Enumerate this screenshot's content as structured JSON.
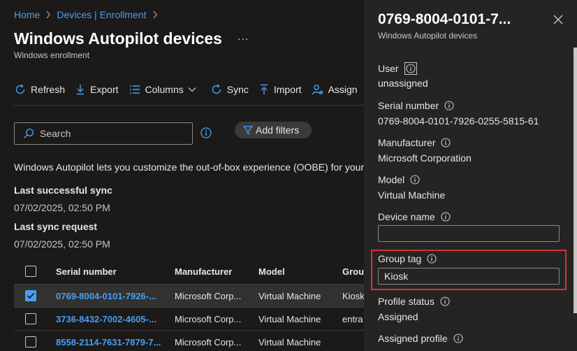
{
  "breadcrumb": {
    "items": [
      "Home",
      "Devices | Enrollment"
    ]
  },
  "page": {
    "title": "Windows Autopilot devices",
    "more_label": "...",
    "subtitle": "Windows enrollment"
  },
  "toolbar": {
    "refresh_label": "Refresh",
    "export_label": "Export",
    "columns_label": "Columns",
    "sync_label": "Sync",
    "import_label": "Import",
    "assign_label": "Assign"
  },
  "search": {
    "placeholder": "Search"
  },
  "filters": {
    "add_label": "Add filters"
  },
  "description": "Windows Autopilot lets you customize the out-of-box experience (OOBE) for your",
  "sync": {
    "last_successful_label": "Last successful sync",
    "last_successful_value": "07/02/2025, 02:50 PM",
    "last_request_label": "Last sync request",
    "last_request_value": "07/02/2025, 02:50 PM"
  },
  "table": {
    "columns": [
      "Serial number",
      "Manufacturer",
      "Model",
      "Group"
    ],
    "rows": [
      {
        "serial": "0769-8004-0101-7926-...",
        "manufacturer": "Microsoft Corp...",
        "model": "Virtual Machine",
        "group": "Kiosk",
        "checked": true
      },
      {
        "serial": "3736-8432-7002-4605-...",
        "manufacturer": "Microsoft Corp...",
        "model": "Virtual Machine",
        "group": "entra",
        "checked": false
      },
      {
        "serial": "8558-2114-7631-7879-7...",
        "manufacturer": "Microsoft Corp...",
        "model": "Virtual Machine",
        "group": "",
        "checked": false
      }
    ]
  },
  "panel": {
    "title": "0769-8004-0101-7...",
    "subtitle": "Windows Autopilot devices",
    "user_label": "User",
    "user_value": "unassigned",
    "serial_label": "Serial number",
    "serial_value": "0769-8004-0101-7926-0255-5815-61",
    "manufacturer_label": "Manufacturer",
    "manufacturer_value": "Microsoft Corporation",
    "model_label": "Model",
    "model_value": "Virtual Machine",
    "device_name_label": "Device name",
    "device_name_value": "",
    "group_tag_label": "Group tag",
    "group_tag_value": "Kiosk",
    "profile_status_label": "Profile status",
    "profile_status_value": "Assigned",
    "assigned_profile_label": "Assigned profile"
  },
  "colors": {
    "background": "#1b1a19",
    "panel": "#252423",
    "link": "#479ef5",
    "highlight": "#d13438"
  },
  "icons": [
    "chevron-right-icon",
    "more-icon",
    "refresh-icon",
    "download-icon",
    "columns-icon",
    "chevron-down-icon",
    "sync-icon",
    "upload-icon",
    "add-person-icon",
    "search-icon",
    "info-icon",
    "filter-icon",
    "checkmark-icon",
    "close-icon"
  ]
}
